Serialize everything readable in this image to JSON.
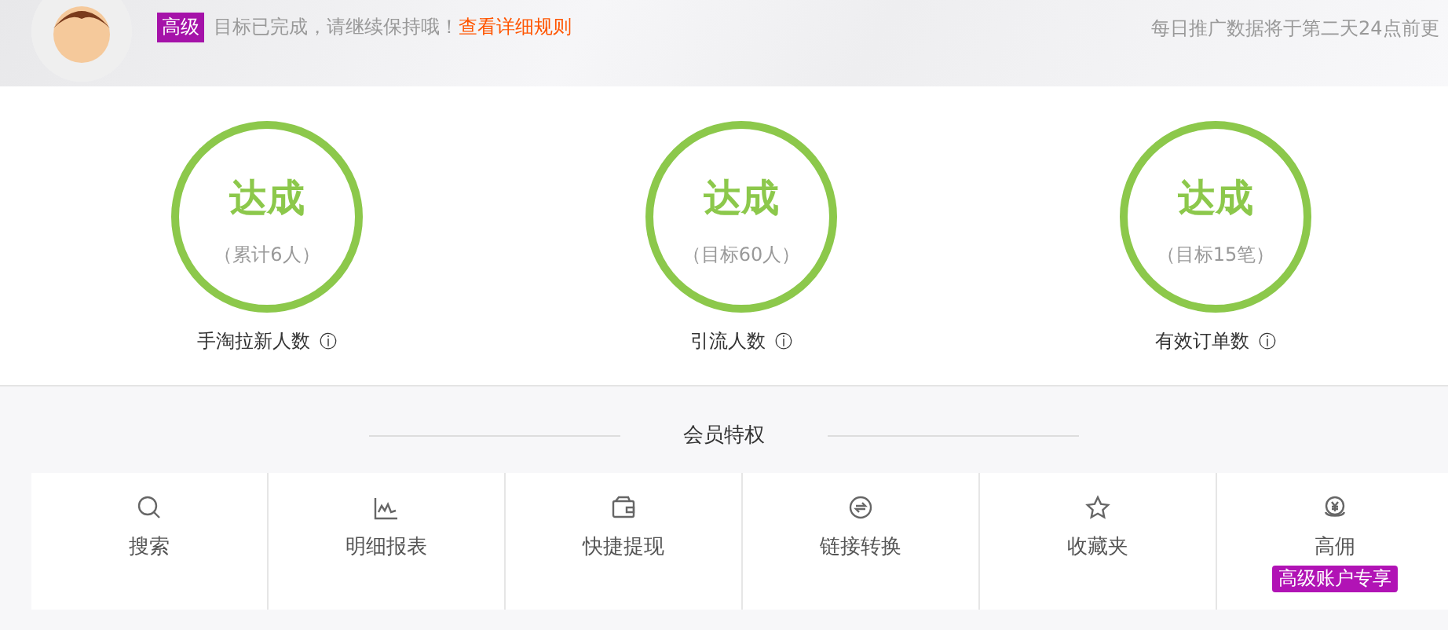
{
  "header": {
    "level_badge": "高级",
    "message": "目标已完成，请继续保持哦！",
    "rules_link": "查看详细规则",
    "notice": "每日推广数据将于第二天24点前更"
  },
  "metrics": [
    {
      "status": "达成",
      "detail": "（累计6人）",
      "label": "手淘拉新人数",
      "info": "ⓘ"
    },
    {
      "status": "达成",
      "detail": "（目标60人）",
      "label": "引流人数",
      "info": "ⓘ"
    },
    {
      "status": "达成",
      "detail": "（目标15笔）",
      "label": "有效订单数",
      "info": "ⓘ"
    }
  ],
  "privileges": {
    "title": "会员特权",
    "items": [
      {
        "kind": "search",
        "label": "搜索"
      },
      {
        "kind": "chart",
        "label": "明细报表"
      },
      {
        "kind": "wallet",
        "label": "快捷提现"
      },
      {
        "kind": "convert",
        "label": "链接转换"
      },
      {
        "kind": "star",
        "label": "收藏夹"
      },
      {
        "kind": "coin",
        "label": "高佣",
        "tag": "高级账户专享"
      }
    ]
  }
}
